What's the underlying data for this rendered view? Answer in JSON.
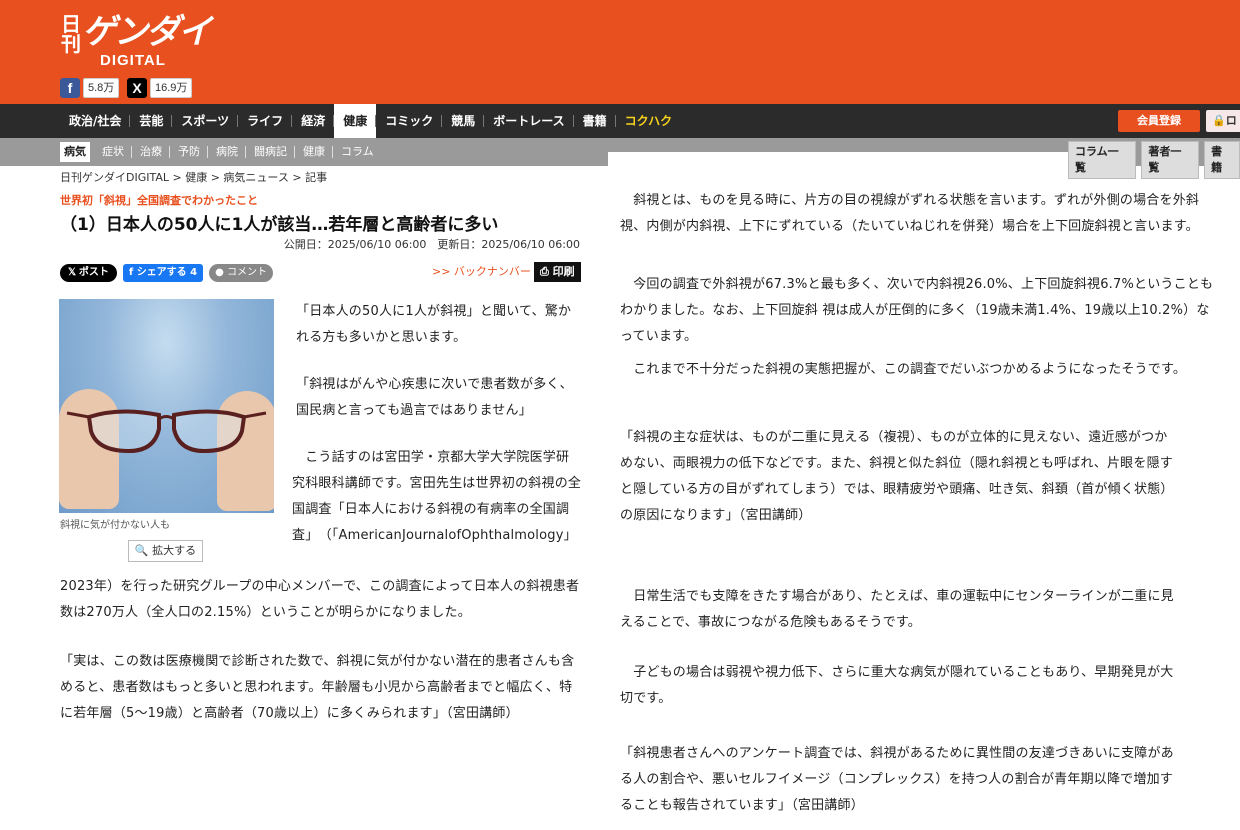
{
  "header": {
    "logo_nikkan": "日刊",
    "logo_main": "ゲンダイ",
    "logo_digital": "DIGITAL",
    "facebook_count": "5.8万",
    "x_count": "16.9万",
    "brand_color": "#e8501f"
  },
  "nav": {
    "items": [
      "政治/社会",
      "芸能",
      "スポーツ",
      "ライフ",
      "経済",
      "健康",
      "コミック",
      "競馬",
      "ボートレース",
      "書籍",
      "コクハク"
    ],
    "active": "健康",
    "member_button": "会員登録",
    "login_button": "ロ"
  },
  "subnav": {
    "items": [
      "病気",
      "症状",
      "治療",
      "予防",
      "病院",
      "闘病記",
      "健康",
      "コラム"
    ],
    "active": "病気",
    "right_buttons": [
      "コラム一覧",
      "著者一覧",
      "書籍"
    ]
  },
  "article": {
    "breadcrumb": "日刊ゲンダイDIGITAL > 健康 > 病気ニュース > 記事",
    "kicker": "世界初「斜視」全国調査でわかったこと",
    "headline": "（1）日本人の50人に1人が該当…若年層と高齢者に多い",
    "dates": "公開日：2025/06/10 06:00　更新日：2025/06/10 06:00",
    "share_x": "ポスト",
    "share_fb": "シェアする 4",
    "share_comment": "コメント",
    "back_number": ">> バックナンバー",
    "print": "印刷",
    "photo_caption": "斜視に気が付かない人も",
    "zoom_button": "拡大する",
    "paragraphs": [
      "「日本人の50人に1人が斜視」と聞いて、驚かれる方も多いかと思います。",
      "「斜視はがんや心疾患に次いで患者数が多く、国民病と言っても過言ではありません」",
      "　こう話すのは宮田学・京都大学大学院医学研究科眼科講師です。宮田先生は世界初の斜視の全国調査「日本人における斜視の有病率の全国調査」　（「AmericanJournalofOphthalmology」",
      "2023年）を行った研究グループの中心メンバーで、この調査によって日本人の斜視患者数は270万人（全人口の2.15%）ということが明らかになりました。",
      "「実は、この数は医療機関で診断された数で、斜視に気が付かない潜在的患者さんも含めると、患者数はもっと多いと思われます。年齢層も小児から高齢者までと幅広く、特に若年層（5～19歳）と高齢者（70歳以上）に多くみられます」（宮田講師）"
    ],
    "right_paragraphs": [
      "　斜視とは、ものを見る時に、片方の目の視線がずれる状態を言います。ずれが外側の場合を外斜視、内側が内斜視、上下にずれている（たいていねじれを併発）場合を上下回旋斜視と言います。",
      "　今回の調査で外斜視が67.3%と最も多く、次いで内斜視26.0%、上下回旋斜視6.7%ということもわかりました。なお、上下回旋斜 視は成人が圧倒的に多く（19歳未満1.4%、19歳以上10.2%）なっています。",
      "　これまで不十分だった斜視の実態把握が、この調査でだいぶつかめるようになったそうです。",
      "「斜視の主な症状は、ものが二重に見える（複視）、ものが立体的に見えない、遠近感がつかめない、両眼視力の低下などです。また、斜視と似た斜位（隠れ斜視とも呼ばれ、片眼を隠すと隠している方の目がずれてしまう）では、眼精疲労や頭痛、吐き気、斜頚（首が傾く状態）の原因になります」（宮田講師）",
      "　日常生活でも支障をきたす場合があり、たとえば、車の運転中にセンターラインが二重に見えることで、事故につながる危険もあるそうです。",
      "　子どもの場合は弱視や視力低下、さらに重大な病気が隠れていることもあり、早期発見が大切です。",
      "「斜視患者さんへのアンケート調査では、斜視があるために異性間の友達づきあいに支障がある人の割合や、悪いセルフイメージ（コンプレックス）を持つ人の割合が青年期以降で増加することも報告されています」（宮田講師）"
    ]
  }
}
